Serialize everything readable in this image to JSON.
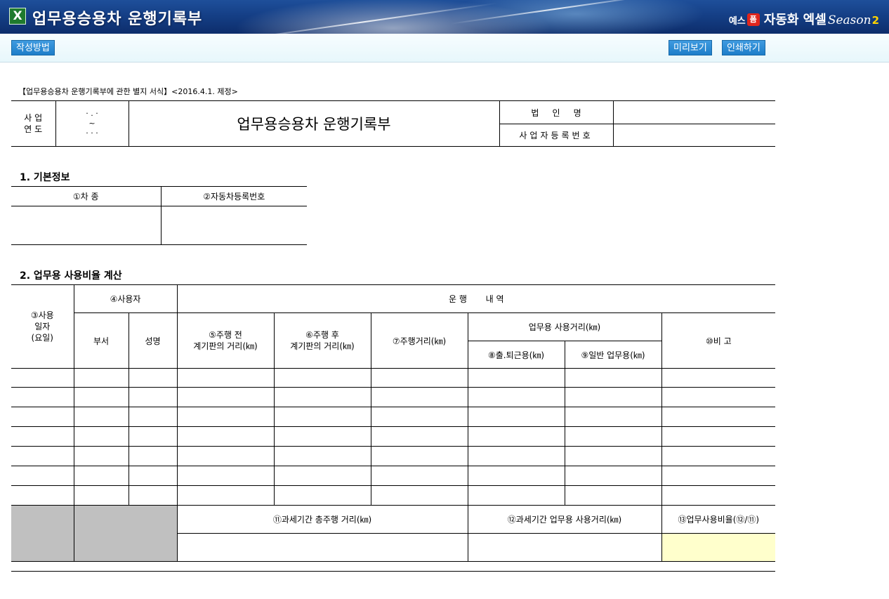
{
  "app": {
    "title": "업무용승용차 운행기록부",
    "icon": "excel-icon",
    "brand": {
      "prefix": "예스",
      "logo": "폼",
      "name": "자동화 엑셀",
      "season": "Season",
      "season_num": "2"
    }
  },
  "toolbar": {
    "guide_label": "작성방법",
    "preview_label": "미리보기",
    "print_label": "인쇄하기"
  },
  "form": {
    "subtitle": "【업무용승용차 운행기록부에 관한 별지 서식】<2016.4.1. 제정>",
    "year_label": "사 업\n연 도",
    "year_top": "·  .  ·",
    "year_mid": "~",
    "year_bot": "·  ·  ·",
    "title": "업무용승용차 운행기록부",
    "corp_label": "법     인     명",
    "bizno_label": "사업자등록번호",
    "corp_value": "",
    "bizno_value": ""
  },
  "section1": {
    "title": "1. 기본정보",
    "col1": "①차 종",
    "col2": "②자동차등록번호"
  },
  "section2": {
    "title": "2. 업무용 사용비율 계산",
    "date_col": "③사용\n일자\n(요일)",
    "user_col": "④사용자",
    "dept": "부서",
    "name": "성명",
    "drive_header": "운 행       내 역",
    "before": "⑤주행 전\n계기판의 거리(㎞)",
    "after": "⑥주행 후\n계기판의 거리(㎞)",
    "distance": "⑦주행거리(㎞)",
    "biz_header": "업무용 사용거리(㎞)",
    "commute": "⑧출.퇴근용(㎞)",
    "general": "⑨일반 업무용(㎞)",
    "note": "⑩비 고",
    "total_dist": "⑪과세기간 총주행 거리(㎞)",
    "total_biz": "⑫과세기간 업무용 사용거리(㎞)",
    "ratio": "⑬업무사용비율(⑫/⑪)",
    "row_count": 7
  },
  "colors": {
    "titlebar": "#153f86",
    "button": "#1e7ec9",
    "gray_cell": "#c0c0c0",
    "ratio_cell": "#ffffcc"
  }
}
